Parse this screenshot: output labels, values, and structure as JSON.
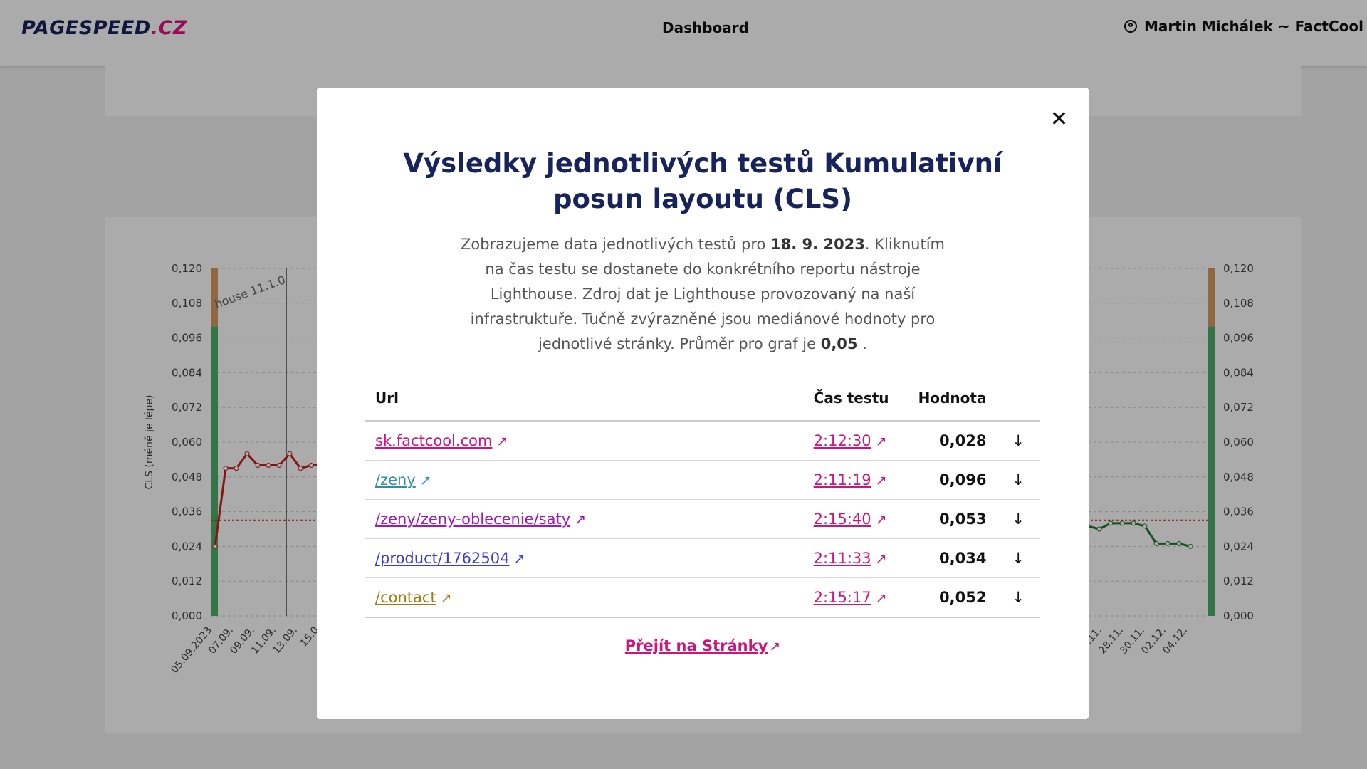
{
  "header": {
    "logo_main": "PAGESPEED",
    "logo_tld": ".CZ",
    "nav_dashboard": "Dashboard",
    "user_label": "Martin Michálek ~ FactCool",
    "user_icon": "user-circle-icon"
  },
  "modal": {
    "title": "Výsledky jednotlivých testů Kumulativní posun layoutu (CLS)",
    "desc_part1": "Zobrazujeme data jednotlivých testů pro",
    "desc_date": "18. 9. 2023",
    "desc_part2": ". Kliknutím na čas testu se dostanete do konkrétního reportu nástroje Lighthouse. Zdroj dat je Lighthouse provozovaný na naší infrastruktuře. Tučně zvýrazněné jsou mediánové hodnoty pro jednotlivé stránky. Průměr pro graf je",
    "desc_avg": "0,05",
    "desc_part3": ".",
    "close_icon": "close-icon",
    "table": {
      "headers": {
        "url": "Url",
        "time": "Čas testu",
        "value": "Hodnota"
      },
      "rows": [
        {
          "url": "sk.factcool.com",
          "url_color": "#d0127b",
          "time": "2:12:30",
          "value": "0,028"
        },
        {
          "url": "/zeny",
          "url_color": "#2f8fa8",
          "time": "2:11:19",
          "value": "0,096"
        },
        {
          "url": "/zeny/zeny-oblecenie/saty",
          "url_color": "#a214c8",
          "time": "2:15:40",
          "value": "0,053"
        },
        {
          "url": "/product/1762504",
          "url_color": "#3a3ad6",
          "time": "2:11:33",
          "value": "0,034"
        },
        {
          "url": "/contact",
          "url_color": "#a37a10",
          "time": "2:15:17",
          "value": "0,052"
        }
      ],
      "external_icon": "↗",
      "sort_icon": "↓"
    },
    "cta_label": "Přejít na Stránky"
  },
  "background_chart": {
    "y_ticks": [
      "0,000",
      "0,012",
      "0,024",
      "0,036",
      "0,048",
      "0,060",
      "0,072",
      "0,084",
      "0,096",
      "0,108",
      "0,120"
    ],
    "y_axis_label": "CLS (méně je lépe)",
    "annotation": "house 11.1.0",
    "x_ticks_left": [
      "05.09.2023",
      "07.09.",
      "09.09.",
      "11.09.",
      "13.09.",
      "15.0"
    ],
    "x_ticks_right": [
      "..11.",
      "28.11.",
      "30.11.",
      "02.12.",
      "04.12."
    ],
    "colors": {
      "good": "#4caf6a",
      "warn": "#d99a63",
      "bad_line": "#c81e1e",
      "good_line": "#1f7a2a",
      "threshold": "#c81e1e"
    }
  }
}
